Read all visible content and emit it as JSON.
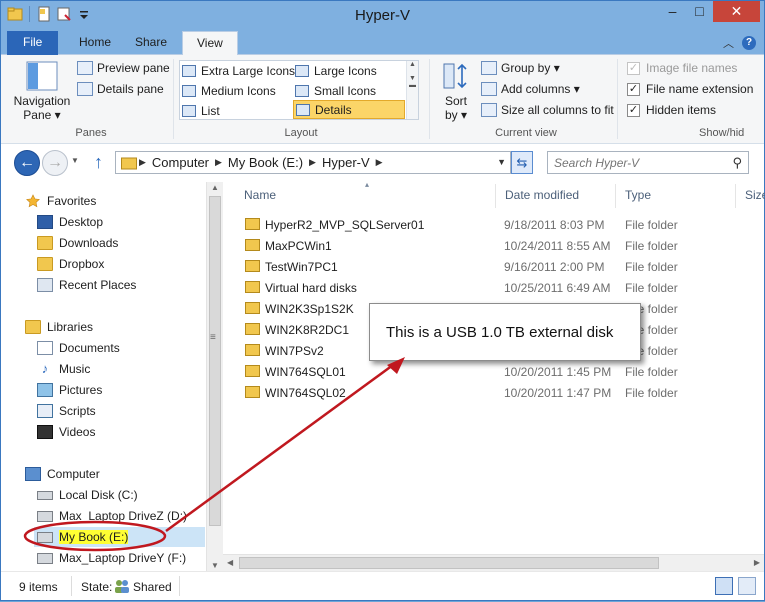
{
  "window": {
    "title": "Hyper-V",
    "minimize": "–",
    "maximize": "□",
    "close": "✕"
  },
  "ribbon_tabs": {
    "file": "File",
    "home": "Home",
    "share": "Share",
    "view": "View"
  },
  "ribbon": {
    "panes": {
      "navigation_pane": "Navigation",
      "navigation_pane_line2": "Pane ▾",
      "preview_pane": "Preview pane",
      "details_pane": "Details pane",
      "label": "Panes"
    },
    "layout": {
      "extra_large": "Extra Large Icons",
      "large": "Large Icons",
      "medium": "Medium Icons",
      "small": "Small Icons",
      "list": "List",
      "details": "Details",
      "label": "Layout"
    },
    "current_view": {
      "sort_by": "Sort",
      "sort_by_line2": "by ▾",
      "group_by": "Group by ▾",
      "add_columns": "Add columns ▾",
      "size_all_columns": "Size all columns to fit",
      "label": "Current view"
    },
    "show_hide": {
      "item_checkboxes": "Image file names",
      "file_name_extensions": "File name extension",
      "hidden_items": "Hidden items",
      "label": "Show/hid"
    }
  },
  "address": {
    "crumbs": [
      "Computer",
      "My Book (E:)",
      "Hyper-V"
    ],
    "search_placeholder": "Search Hyper-V"
  },
  "nav_pane": {
    "favorites": "Favorites",
    "desktop": "Desktop",
    "downloads": "Downloads",
    "dropbox": "Dropbox",
    "recent_places": "Recent Places",
    "libraries": "Libraries",
    "documents": "Documents",
    "music": "Music",
    "pictures": "Pictures",
    "scripts": "Scripts",
    "videos": "Videos",
    "computer": "Computer",
    "local_disk": "Local Disk (C:)",
    "max_laptop_z": "Max_Laptop DriveZ (D:)",
    "my_book": "My Book (E:)",
    "max_laptop_y": "Max_Laptop DriveY (F:)"
  },
  "columns": {
    "name": "Name",
    "date": "Date modified",
    "type": "Type",
    "size": "Size"
  },
  "files": [
    {
      "name": "HyperR2_MVP_SQLServer01",
      "date": "9/18/2011 8:03 PM",
      "type": "File folder"
    },
    {
      "name": "MaxPCWin1",
      "date": "10/24/2011 8:55 AM",
      "type": "File folder"
    },
    {
      "name": "TestWin7PC1",
      "date": "9/16/2011 2:00 PM",
      "type": "File folder"
    },
    {
      "name": "Virtual hard disks",
      "date": "10/25/2011 6:49 AM",
      "type": "File folder"
    },
    {
      "name": "WIN2K3Sp1S2K",
      "date": "",
      "type": "File folder"
    },
    {
      "name": "WIN2K8R2DC1",
      "date": "",
      "type": "File folder"
    },
    {
      "name": "WIN7PSv2",
      "date": "",
      "type": "File folder"
    },
    {
      "name": "WIN764SQL01",
      "date": "10/20/2011 1:45 PM",
      "type": "File folder"
    },
    {
      "name": "WIN764SQL02",
      "date": "10/20/2011 1:47 PM",
      "type": "File folder"
    }
  ],
  "status": {
    "count": "9 items",
    "state_label": "State:",
    "state_value": "Shared"
  },
  "callout": {
    "text": "This is a USB 1.0 TB external disk"
  },
  "colors": {
    "accent": "#2b66b8",
    "title_bar": "#7fb0e0",
    "annotation_red": "#c0181f",
    "highlight": "#ffff33"
  }
}
